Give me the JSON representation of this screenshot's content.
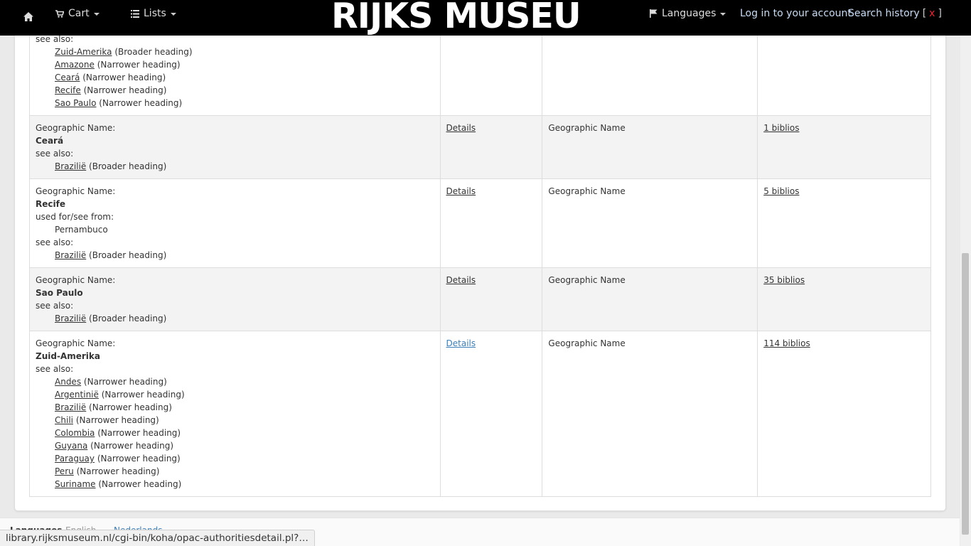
{
  "navbar": {
    "home_icon": "home-icon",
    "cart_label": "Cart",
    "lists_label": "Lists",
    "brand": "RIJKS MUSEUM",
    "languages_label": "Languages",
    "login_label": "Log in to your account",
    "search_history_label": "Search history",
    "search_history_bracket_open": "[",
    "search_history_clear": "x",
    "search_history_bracket_close": "]"
  },
  "records": [
    {
      "partial": true,
      "see_also_label": "see also:",
      "see_also": [
        {
          "name": "Zuid-Amerika",
          "rel": "(Broader heading)"
        },
        {
          "name": "Amazone",
          "rel": "(Narrower heading)"
        },
        {
          "name": "Ceará",
          "rel": "(Narrower heading)"
        },
        {
          "name": "Recife",
          "rel": "(Narrower heading)"
        },
        {
          "name": "Sao Paulo",
          "rel": "(Narrower heading)"
        }
      ]
    },
    {
      "type_label": "Geographic Name:",
      "heading": "Ceará",
      "see_also_label": "see also:",
      "see_also": [
        {
          "name": "Brazilië",
          "rel": "(Broader heading)"
        }
      ],
      "details": "Details",
      "auth_type": "Geographic Name",
      "biblios": "1 biblios"
    },
    {
      "type_label": "Geographic Name:",
      "heading": "Recife",
      "used_for_label": "used for/see from:",
      "used_for": [
        "Pernambuco"
      ],
      "see_also_label": "see also:",
      "see_also": [
        {
          "name": "Brazilië",
          "rel": "(Broader heading)"
        }
      ],
      "details": "Details",
      "auth_type": "Geographic Name",
      "biblios": "5 biblios"
    },
    {
      "type_label": "Geographic Name:",
      "heading": "Sao Paulo",
      "see_also_label": "see also:",
      "see_also": [
        {
          "name": "Brazilië",
          "rel": "(Broader heading)"
        }
      ],
      "details": "Details",
      "auth_type": "Geographic Name",
      "biblios": "35 biblios"
    },
    {
      "type_label": "Geographic Name:",
      "heading": "Zuid-Amerika",
      "see_also_label": "see also:",
      "see_also": [
        {
          "name": "Andes",
          "rel": "(Narrower heading)"
        },
        {
          "name": "Argentinië",
          "rel": "(Narrower heading)"
        },
        {
          "name": "Brazilië",
          "rel": "(Narrower heading)"
        },
        {
          "name": "Chili",
          "rel": "(Narrower heading)"
        },
        {
          "name": "Colombia",
          "rel": "(Narrower heading)"
        },
        {
          "name": "Guyana",
          "rel": "(Narrower heading)"
        },
        {
          "name": "Paraguay",
          "rel": "(Narrower heading)"
        },
        {
          "name": "Peru",
          "rel": "(Narrower heading)"
        },
        {
          "name": "Suriname",
          "rel": "(Narrower heading)"
        }
      ],
      "details": "Details",
      "auth_type": "Geographic Name",
      "biblios": "114 biblios"
    }
  ],
  "footer": {
    "languages_label": "Languages",
    "english": "English",
    "nederlands": "Nederlands"
  },
  "status_url": "library.rijksmuseum.nl/cgi-bin/koha/opac-authoritiesdetail.pl?…"
}
